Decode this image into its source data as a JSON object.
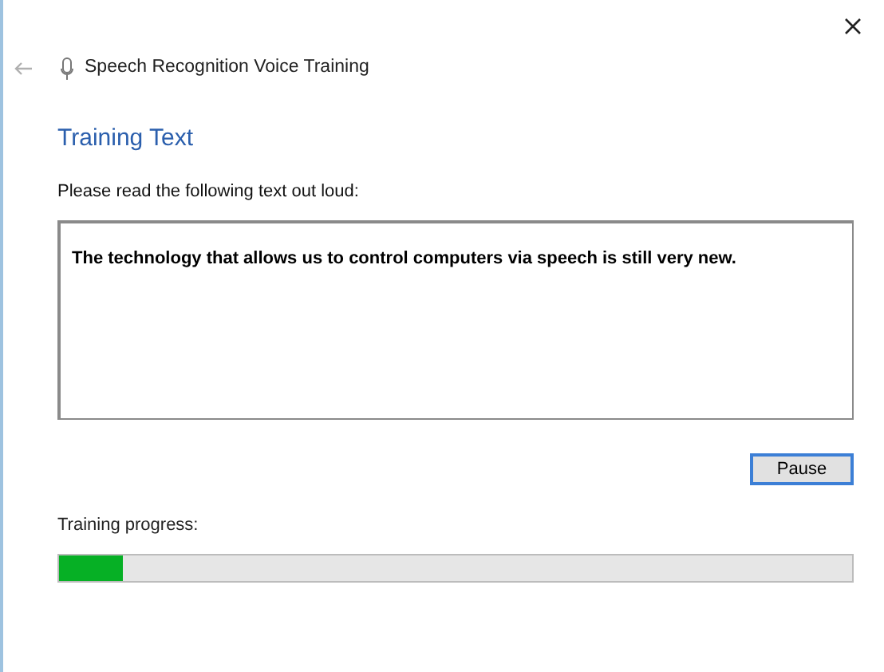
{
  "window": {
    "title": "Speech Recognition Voice Training"
  },
  "heading": "Training Text",
  "instruction": "Please read the following text out loud:",
  "training_text": "The technology that allows us to control computers via speech is still very new.",
  "buttons": [
    "Pause"
  ],
  "progress": {
    "label": "Training progress:",
    "level": 0.08
  }
}
